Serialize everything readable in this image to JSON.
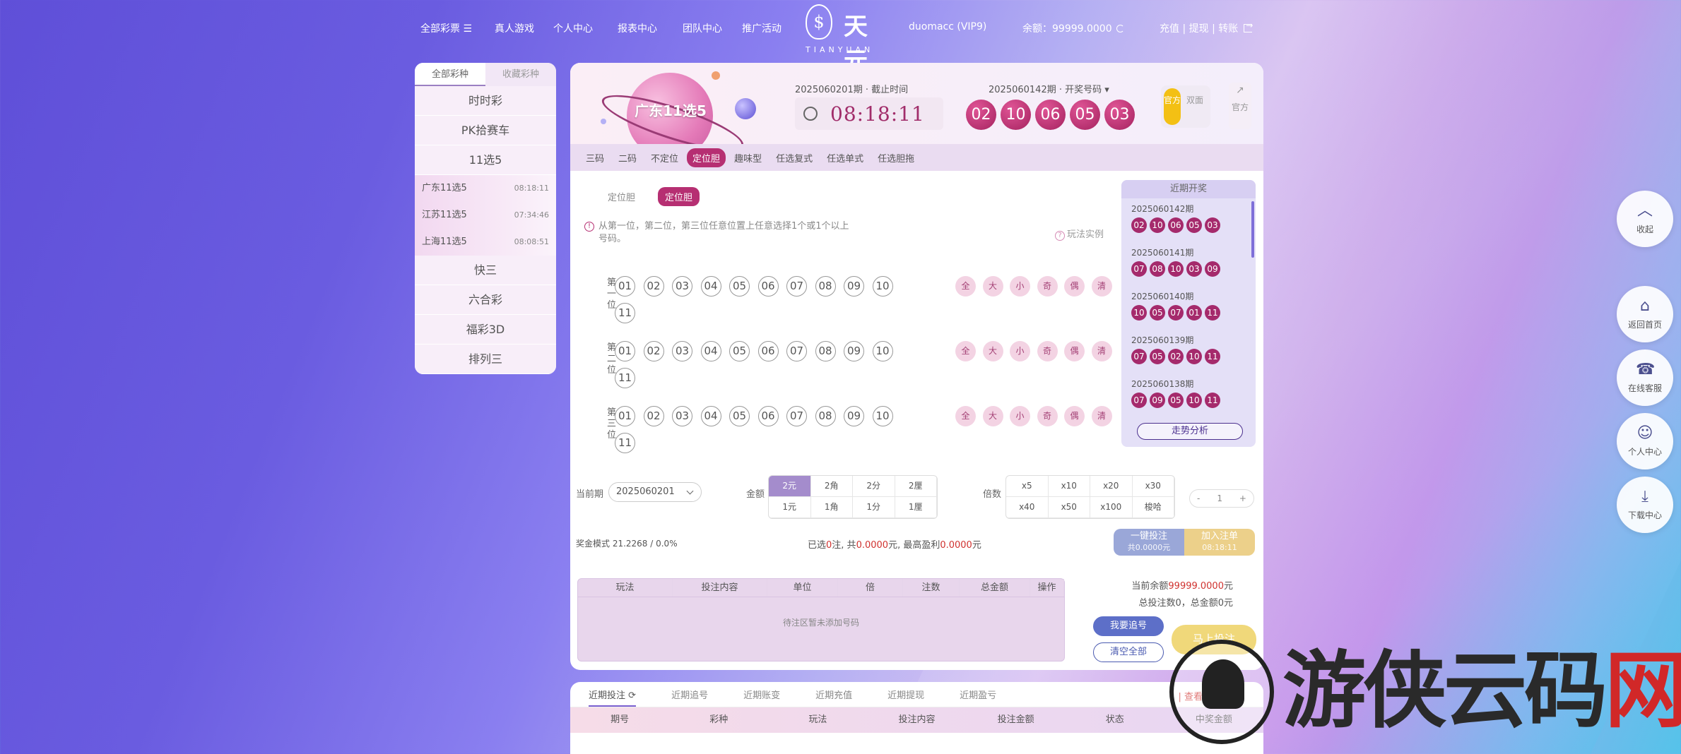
{
  "nav": {
    "left": [
      "全部彩票 ☰",
      "真人游戏",
      "个人中心",
      "报表中心",
      "团队中心",
      "推广活动"
    ],
    "logo_cn": "天元",
    "logo_en": "TIANYUAN",
    "logo_mark": "$",
    "user": "duomacc (VIP9)",
    "balance": "余额：99999.0000",
    "actions": "充值 | 提现 | 转账"
  },
  "sidebar": {
    "tabs": [
      "全部彩种",
      "收藏彩种"
    ],
    "cats_top": [
      "时时彩",
      "PK拾赛车",
      "11选5"
    ],
    "subs": [
      {
        "name": "广东11选5",
        "time": "08:18:11"
      },
      {
        "name": "江苏11选5",
        "time": "07:34:46"
      },
      {
        "name": "上海11选5",
        "time": "08:08:51"
      }
    ],
    "cats_bottom": [
      "快三",
      "六合彩",
      "福彩3D",
      "排列三"
    ]
  },
  "header": {
    "lottery_name": "广东11选5",
    "current_issue": "2025060201期 · 截止时间",
    "countdown": "08:18:11",
    "draw_issue": "2025060142期 · 开奖号码 ▾",
    "draw_numbers": [
      "02",
      "10",
      "06",
      "05",
      "03"
    ],
    "mode_on": "官方",
    "mode_off": "双面",
    "guanfang": "官方"
  },
  "play_tabs": [
    "三码",
    "二码",
    "不定位",
    "定位胆",
    "趣味型",
    "任选复式",
    "任选单式",
    "任选胆拖"
  ],
  "play_tab_active": 3,
  "sub_tabs": [
    "定位胆",
    "定位胆"
  ],
  "description": "从第一位，第二位，第三位任意位置上任意选择1个或1个以上号码。",
  "example": "玩法实例",
  "positions": [
    {
      "label": "第一位"
    },
    {
      "label": "第二位"
    },
    {
      "label": "第三位"
    }
  ],
  "numbers": [
    "01",
    "02",
    "03",
    "04",
    "05",
    "06",
    "07",
    "08",
    "09",
    "10",
    "11"
  ],
  "quick": [
    "全",
    "大",
    "小",
    "奇",
    "偶",
    "清"
  ],
  "recent": {
    "title": "近期开奖",
    "items": [
      {
        "issue": "2025060142期",
        "balls": [
          "02",
          "10",
          "06",
          "05",
          "03"
        ]
      },
      {
        "issue": "2025060141期",
        "balls": [
          "07",
          "08",
          "10",
          "03",
          "09"
        ]
      },
      {
        "issue": "2025060140期",
        "balls": [
          "10",
          "05",
          "07",
          "01",
          "11"
        ]
      },
      {
        "issue": "2025060139期",
        "balls": [
          "07",
          "05",
          "02",
          "10",
          "11"
        ]
      },
      {
        "issue": "2025060138期",
        "balls": [
          "07",
          "09",
          "05",
          "10",
          "11"
        ]
      }
    ],
    "trend": "走势分析"
  },
  "bet": {
    "period_label": "当前期",
    "period_value": "2025060201",
    "amount_label": "金额",
    "amounts": [
      "2元",
      "2角",
      "2分",
      "2厘",
      "1元",
      "1角",
      "1分",
      "1厘"
    ],
    "multiple_label": "倍数",
    "multiples": [
      "x5",
      "x10",
      "x20",
      "x30",
      "x40",
      "x50",
      "x100",
      "梭哈"
    ],
    "stepper_minus": "-",
    "stepper_value": "1",
    "stepper_plus": "+",
    "prize_mode": "奖金模式  21.2268 / 0.0%",
    "summary_pre": "已选",
    "summary_count": "0",
    "summary_mid1": "注, 共",
    "summary_total": "0.0000",
    "summary_mid2": "元, 最高盈利",
    "summary_profit": "0.0000",
    "summary_post": "元",
    "one_click": "一键投注",
    "one_click_sub": "共0.0000元",
    "add_cart": "加入注单",
    "add_cart_sub": "08:18:11"
  },
  "betlist": {
    "headers": [
      "玩法",
      "投注内容",
      "单位",
      "倍",
      "注数",
      "总金额",
      "操作"
    ],
    "empty": "待注区暂未添加号码"
  },
  "balance_box": {
    "line1_pre": "当前余额",
    "line1_val": "99999.0000",
    "line1_post": "元",
    "line2": "总投注数0，总金额0元",
    "zhui": "我要追号",
    "clear": "清空全部",
    "bet_now": "马上投注"
  },
  "bottom": {
    "tabs": [
      "近期投注",
      "近期追号",
      "近期账变",
      "近期充值",
      "近期提现",
      "近期盈亏"
    ],
    "view_all": "| 查看全部",
    "headers": [
      "期号",
      "彩种",
      "玩法",
      "投注内容",
      "投注金额",
      "状态",
      "中奖金额"
    ]
  },
  "floats": [
    {
      "icon": "︿",
      "label": "收起"
    },
    {
      "icon": "⌂",
      "label": "返回首页"
    },
    {
      "icon": "☎",
      "label": "在线客服"
    },
    {
      "icon": "☺",
      "label": "个人中心"
    },
    {
      "icon": "⤓",
      "label": "下载中心"
    }
  ],
  "watermark": {
    "text": "游侠云码",
    "x": "网"
  }
}
